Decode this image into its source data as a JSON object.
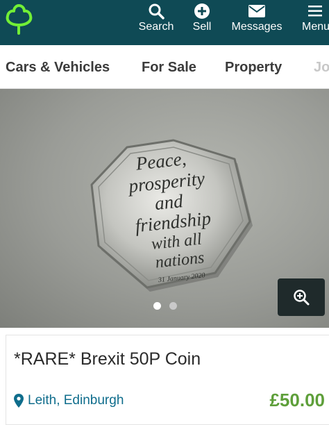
{
  "header": {
    "nav": [
      {
        "label": "Search",
        "icon": "search-icon"
      },
      {
        "label": "Sell",
        "icon": "plus-circle-icon"
      },
      {
        "label": "Messages",
        "icon": "envelope-icon"
      },
      {
        "label": "Menu",
        "icon": "hamburger-icon"
      }
    ],
    "logo_icon": "tree-logo-icon"
  },
  "categories": [
    "Cars & Vehicles",
    "For Sale",
    "Property",
    "Jo"
  ],
  "gallery": {
    "coin_lines": [
      "Peace,",
      "prosperity",
      "and",
      "friendship",
      "with all",
      "nations"
    ],
    "coin_date": "31 January 2020",
    "image_count": 2,
    "active_index": 1,
    "zoom_icon": "zoom-in-icon"
  },
  "listing": {
    "title": "*RARE* Brexit 50P Coin",
    "location": "Leith, Edinburgh",
    "price": "£50.00",
    "location_icon": "map-pin-icon"
  },
  "colors": {
    "header_bg": "#0f4a55",
    "brand_green": "#72ef36",
    "price_green": "#5e9f3a",
    "location_blue": "#0f6d8c",
    "zoom_bg": "#1f2a2b"
  }
}
